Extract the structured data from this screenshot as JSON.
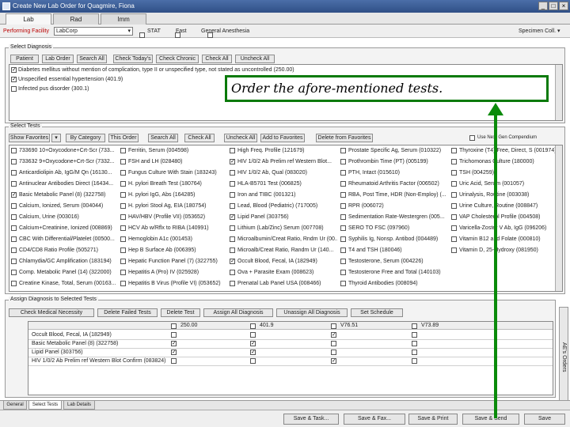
{
  "window": {
    "title": "Create New Lab Order for Quagmire, Fiona",
    "min": "_",
    "max": "□",
    "close": "×"
  },
  "tabs": [
    "Lab",
    "Rad",
    "Imm"
  ],
  "toolbar": {
    "facility_label": "Performing Facility",
    "facility_value": "LabCorp",
    "stat_label": "STAT",
    "fast_label": "Fast",
    "general_anesthesia_label": "General Anesthesia",
    "specimen_label": "Specimen Coll. ▾"
  },
  "diagnoses": {
    "title": "Select Diagnosis",
    "buttons": [
      "Patient",
      "Lab Order",
      "Search All",
      "Check Today's",
      "Check Chronic",
      "Check All",
      "Uncheck All"
    ],
    "items": [
      {
        "checked": true,
        "text": "Diabetes mellitus without mention of complication, type II or unspecified type, not stated as uncontrolled (250.00)"
      },
      {
        "checked": true,
        "text": "Unspecified essential hypertension (401.9)"
      },
      {
        "checked": false,
        "text": "Infected pus disorder (300.1)"
      }
    ]
  },
  "tests": {
    "title": "Select Tests",
    "show_favorites": "Show Favorites",
    "by_category": "By Category",
    "buttons": [
      "This Order",
      "Search All",
      "Check All",
      "Uncheck All",
      "Add to Favorites",
      "Delete from Favorites"
    ],
    "use_nextgen_label": "Use Next Gen Compendium",
    "columns": [
      [
        {
          "c": false,
          "t": "733690 10+Oxycodone+Crt-Scr (733..."
        },
        {
          "c": false,
          "t": "733632 9+Oxycodone+Crt-Scr (7332..."
        },
        {
          "c": false,
          "t": "Anticardiolipin Ab, IgG/M Qn (16130..."
        },
        {
          "c": false,
          "t": "Antinuclear Antibodies Direct (16434..."
        },
        {
          "c": true,
          "t": "Basic Metabolic Panel (8) (322758)"
        },
        {
          "c": false,
          "t": "Calcium, Ionized, Serum (004044)"
        },
        {
          "c": false,
          "t": "Calcium, Urine (003016)"
        },
        {
          "c": false,
          "t": "Calcium+Creatinine, Ionized (008869)"
        },
        {
          "c": false,
          "t": "CBC With Differential/Platelet (00500..."
        },
        {
          "c": false,
          "t": "CD4/CD8 Ratio Profile (505271)"
        },
        {
          "c": false,
          "t": "Chlamydia/GC Amplification (183194)"
        },
        {
          "c": false,
          "t": "Comp. Metabolic Panel (14) (322000)"
        },
        {
          "c": false,
          "t": "Creatine Kinase, Total, Serum (00163..."
        }
      ],
      [
        {
          "c": false,
          "t": "Ferritin, Serum (004598)"
        },
        {
          "c": false,
          "t": "FSH and LH (028480)"
        },
        {
          "c": false,
          "t": "Fungus Culture With Stain (183243)"
        },
        {
          "c": false,
          "t": "H. pylori Breath Test (180764)"
        },
        {
          "c": false,
          "t": "H. pylori IgG, Abs (164285)"
        },
        {
          "c": false,
          "t": "H. pylori Stool Ag, EIA (180754)"
        },
        {
          "c": false,
          "t": "HAV/HBV (Profile VII) (053652)"
        },
        {
          "c": false,
          "t": "HCV Ab w/Rflx to RIBA (140991)"
        },
        {
          "c": false,
          "t": "Hemoglobin A1c (001453)"
        },
        {
          "c": false,
          "t": "Hep B Surface Ab (006395)"
        },
        {
          "c": false,
          "t": "Hepatic Function Panel (7) (322755)"
        },
        {
          "c": false,
          "t": "Hepatitis A (Pro) IV (025928)"
        },
        {
          "c": false,
          "t": "Hepatitis B Virus (Profile VI) (053652)"
        }
      ],
      [
        {
          "c": false,
          "t": "High Freq. Profile (121679)"
        },
        {
          "c": true,
          "t": "HIV 1/0/2 Ab Prelim ref Western Blot..."
        },
        {
          "c": false,
          "t": "HIV 1/0/2 Ab, Qual (083020)"
        },
        {
          "c": false,
          "t": "HLA-B5701 Test (006825)"
        },
        {
          "c": false,
          "t": "Iron and TIBC (001321)"
        },
        {
          "c": false,
          "t": "Lead, Blood (Pediatric) (717005)"
        },
        {
          "c": true,
          "t": "Lipid Panel (303756)"
        },
        {
          "c": false,
          "t": "Lithium (Lab/Zinc) Serum (007708)"
        },
        {
          "c": false,
          "t": "Microalbumin/Creat Ratio, Rndm Ur (00..."
        },
        {
          "c": false,
          "t": "Microalb/Creat Ratio, Randm Ur (140..."
        },
        {
          "c": true,
          "t": "Occult Blood, Fecal, IA (182949)"
        },
        {
          "c": false,
          "t": "Ova + Parasite Exam (008623)"
        },
        {
          "c": false,
          "t": "Prenatal Lab Panel USA (008466)"
        }
      ],
      [
        {
          "c": false,
          "t": "Prostate Specific Ag, Serum (010322)"
        },
        {
          "c": false,
          "t": "Prothrombin Time (PT) (005199)"
        },
        {
          "c": false,
          "t": "PTH, Intact (015610)"
        },
        {
          "c": false,
          "t": "Rheumatoid Arthritis Factor (006502)"
        },
        {
          "c": false,
          "t": "RBA, Post Time, HDR (Non-Employ) (..."
        },
        {
          "c": false,
          "t": "RPR (006072)"
        },
        {
          "c": false,
          "t": "Sedimentation Rate-Westergren (005..."
        },
        {
          "c": false,
          "t": "SERO TO FSC (097960)"
        },
        {
          "c": false,
          "t": "Syphilis Ig, Nonsp. Antibod (004489)"
        },
        {
          "c": false,
          "t": "T4 and TSH (180046)"
        },
        {
          "c": false,
          "t": "Testosterone, Serum (004226)"
        },
        {
          "c": false,
          "t": "Testosterone Free and Total (140103)"
        },
        {
          "c": false,
          "t": "Thyroid Antibodies (008094)"
        }
      ],
      [
        {
          "c": false,
          "t": "Thyroxine (T4) Free, Direct, S (001974)"
        },
        {
          "c": false,
          "t": "Trichomonas Culture (180000)"
        },
        {
          "c": false,
          "t": "TSH (004259)"
        },
        {
          "c": false,
          "t": "Uric Acid, Serum (001057)"
        },
        {
          "c": false,
          "t": "Urinalysis, Routine (003038)"
        },
        {
          "c": false,
          "t": "Urine Culture, Routine (008847)"
        },
        {
          "c": false,
          "t": "VAP Cholesterol Profile (004508)"
        },
        {
          "c": false,
          "t": "Varicella-Zoster V Ab, IgG (096206)"
        },
        {
          "c": false,
          "t": "Vitamin B12 and Folate (000810)"
        },
        {
          "c": false,
          "t": "Vitamin D, 25-Hydroxy (081950)"
        }
      ]
    ]
  },
  "assign": {
    "title": "Assign Diagnosis to Selected Tests",
    "buttons": [
      "Check Medical Necessity",
      "Delete Failed Tests",
      "Delete Test",
      "Assign All Diagnosis",
      "Unassign All Diagnosis",
      "Set Schedule"
    ],
    "columns": [
      "250.00",
      "401.9",
      "V76.51",
      "V73.89"
    ],
    "rows": [
      {
        "name": "Occult Blood, Fecal, IA (182949)",
        "checks": [
          false,
          false,
          true,
          false
        ]
      },
      {
        "name": "Basic Metabolic Panel (8) (322758)",
        "checks": [
          true,
          true,
          false,
          false
        ]
      },
      {
        "name": "Lipid Panel (303756)",
        "checks": [
          true,
          true,
          false,
          false
        ]
      },
      {
        "name": "HIV 1/0/2 Ab Prelim ref Western Blot Confirm (083824)",
        "checks": [
          false,
          false,
          true,
          false
        ]
      }
    ],
    "side_tab": "AE's Orders"
  },
  "bottom_tabs": [
    "General",
    "Select Tests",
    "Lab Details"
  ],
  "bottom_buttons": [
    "Save & Task...",
    "Save & Fax...",
    "Save & Print",
    "Save & Send",
    "Save"
  ],
  "callout": "Order the afore-mentioned tests.",
  "colors": {
    "callout_border": "#0a7a0a",
    "arrow": "#0a8a0a",
    "titlebar": "#3a5a94"
  }
}
